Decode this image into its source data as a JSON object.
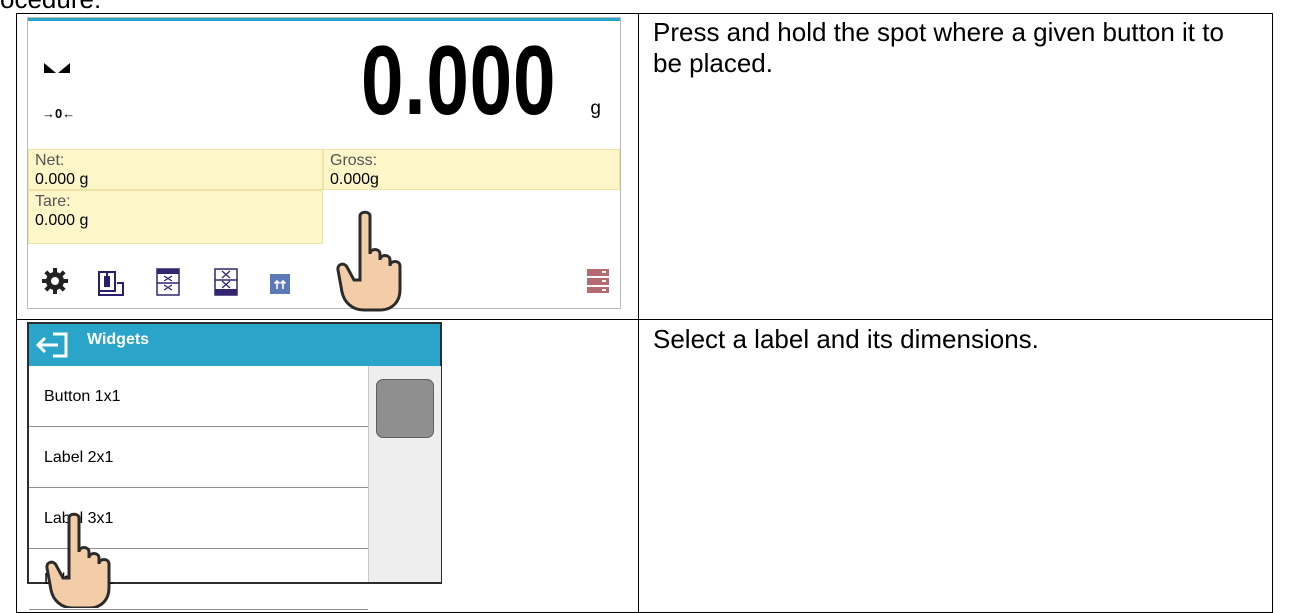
{
  "intro_fragment": "ocedure:",
  "screen1": {
    "weight_value": "0.000",
    "weight_unit": "g",
    "zero_indicator": "→0←",
    "fields": {
      "net": {
        "label": "Net:",
        "value": "0.000 g"
      },
      "gross": {
        "label": "Gross:",
        "value": "0.000g"
      },
      "tare": {
        "label": "Tare:",
        "value": "0.000 g"
      }
    },
    "icons": [
      "settings-icon",
      "print-weight-icon",
      "min-max-icon",
      "tare-icon",
      "parameters-icon",
      "database-icon"
    ],
    "accent": "#2aa4c9",
    "field_bg": "#fdf6c9"
  },
  "instruction1": "Press and hold the spot where a given button it to be placed.",
  "screen2": {
    "title": "Widgets",
    "items": [
      "Button 1x1",
      "Label 2x1",
      "Label 3x1",
      "Label 4x1"
    ]
  },
  "instruction2": "Select a label and its dimensions."
}
